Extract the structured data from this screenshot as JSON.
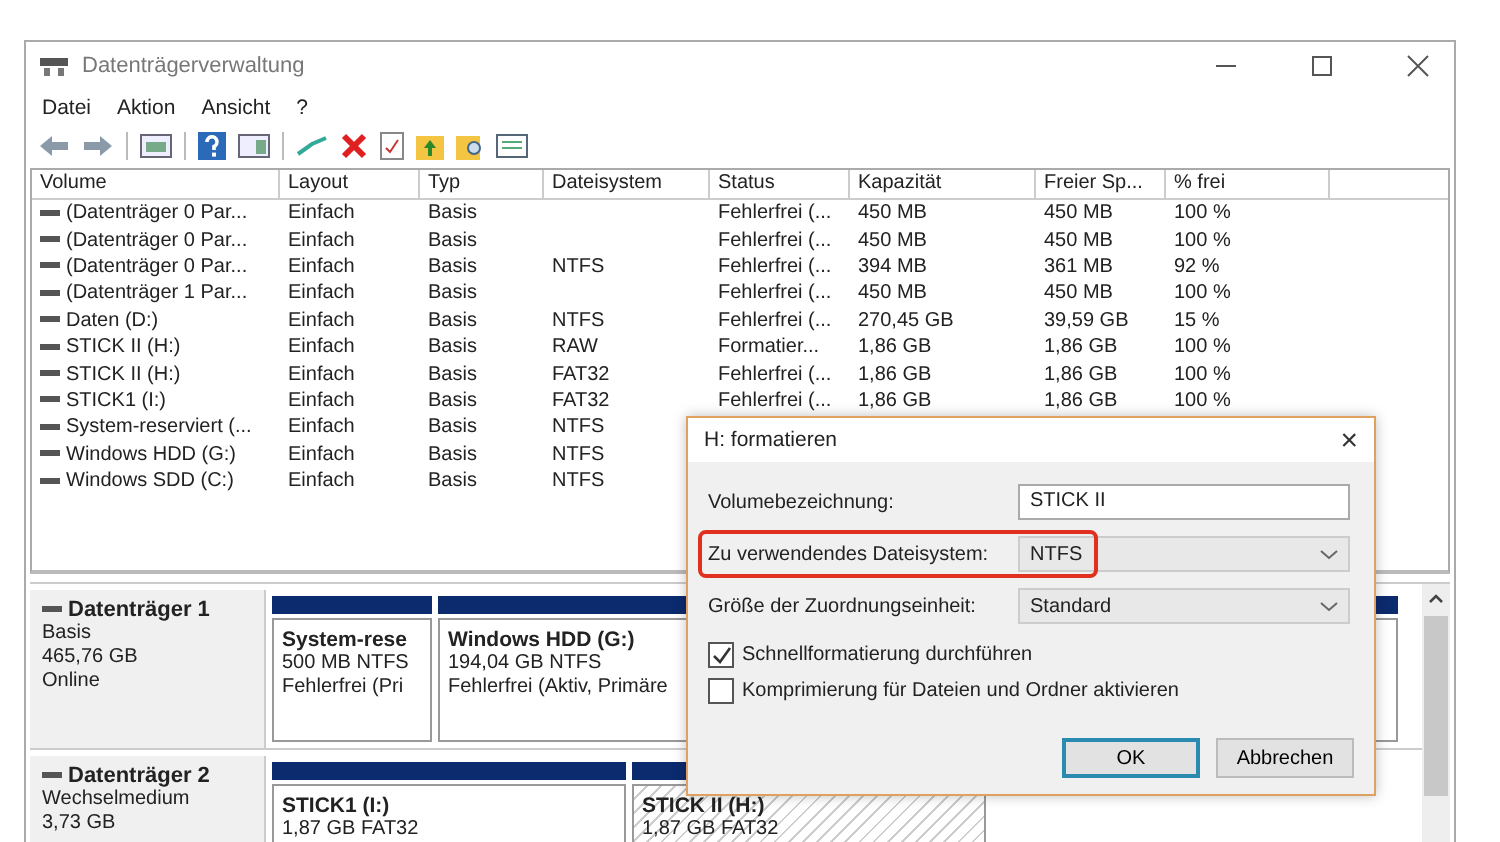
{
  "window": {
    "title": "Datenträgerverwaltung"
  },
  "menu": [
    "Datei",
    "Aktion",
    "Ansicht",
    "?"
  ],
  "table": {
    "columns": [
      "Volume",
      "Layout",
      "Typ",
      "Dateisystem",
      "Status",
      "Kapazität",
      "Freier Sp...",
      "% frei"
    ],
    "rows": [
      {
        "volume": "(Datenträger 0 Par...",
        "layout": "Einfach",
        "type": "Basis",
        "status": "Fehlerfrei (...",
        "capacity": "450 MB",
        "free": "450 MB",
        "percent_free": "100 %"
      },
      {
        "volume": "(Datenträger 0 Par...",
        "layout": "Einfach",
        "type": "Basis",
        "status": "Fehlerfrei (...",
        "capacity": "450 MB",
        "free": "450 MB",
        "percent_free": "100 %"
      },
      {
        "volume": "(Datenträger 0 Par...",
        "layout": "Einfach",
        "type": "Basis",
        "file_system": "NTFS",
        "status": "Fehlerfrei (...",
        "capacity": "394 MB",
        "free": "361 MB",
        "percent_free": "92 %"
      },
      {
        "volume": "(Datenträger 1 Par...",
        "layout": "Einfach",
        "type": "Basis",
        "status": "Fehlerfrei (...",
        "capacity": "450 MB",
        "free": "450 MB",
        "percent_free": "100 %"
      },
      {
        "volume": "Daten (D:)",
        "layout": "Einfach",
        "type": "Basis",
        "file_system": "NTFS",
        "status": "Fehlerfrei (...",
        "capacity": "270,45 GB",
        "free": "39,59 GB",
        "percent_free": "15 %"
      },
      {
        "volume": "STICK II (H:)",
        "layout": "Einfach",
        "type": "Basis",
        "file_system": "RAW",
        "status": "Formatier...",
        "capacity": "1,86 GB",
        "free": "1,86 GB",
        "percent_free": "100 %"
      },
      {
        "volume": "STICK II (H:)",
        "layout": "Einfach",
        "type": "Basis",
        "file_system": "FAT32",
        "status": "Fehlerfrei (...",
        "capacity": "1,86 GB",
        "free": "1,86 GB",
        "percent_free": "100 %"
      },
      {
        "volume": "STICK1 (I:)",
        "layout": "Einfach",
        "type": "Basis",
        "file_system": "FAT32",
        "status": "Fehlerfrei (...",
        "capacity": "1,86 GB",
        "free": "1,86 GB",
        "percent_free": "100 %"
      },
      {
        "volume": "System-reserviert (...",
        "layout": "Einfach",
        "type": "Basis",
        "file_system": "NTFS"
      },
      {
        "volume": "Windows HDD (G:)",
        "layout": "Einfach",
        "type": "Basis",
        "file_system": "NTFS"
      },
      {
        "volume": "Windows SDD (C:)",
        "layout": "Einfach",
        "type": "Basis",
        "file_system": "NTFS"
      }
    ]
  },
  "disks": [
    {
      "name": "Datenträger 1",
      "lines": [
        "Basis",
        "465,76 GB",
        "Online"
      ],
      "partitions": [
        {
          "name": "System-rese",
          "lines": [
            "500 MB NTFS",
            "Fehlerfrei (Pri"
          ],
          "hatched": false
        },
        {
          "name": "Windows HDD  (G:)",
          "lines": [
            "194,04 GB NTFS",
            "Fehlerfrei (Aktiv, Primäre"
          ],
          "hatched": false
        }
      ]
    },
    {
      "name": "Datenträger 2",
      "lines": [
        "Wechselmedium",
        "3,73 GB"
      ],
      "partitions": [
        {
          "name": "STICK1  (I:)",
          "lines": [
            "1,87 GB FAT32"
          ],
          "hatched": false
        },
        {
          "name": "STICK II  (H:)",
          "lines": [
            "1,87 GB FAT32"
          ],
          "hatched": true
        }
      ]
    }
  ],
  "dialog": {
    "title": "H: formatieren",
    "close": "×",
    "fields": [
      {
        "kind": "text",
        "label": "Volumebezeichnung:",
        "value": "STICK II",
        "highlighted": false
      },
      {
        "kind": "select",
        "label": "Zu verwendendes Dateisystem:",
        "value": "NTFS",
        "highlighted": true
      },
      {
        "kind": "select",
        "label": "Größe der Zuordnungseinheit:",
        "value": "Standard",
        "highlighted": false
      }
    ],
    "options": [
      {
        "label": "Schnellformatierung durchführen",
        "checked": true
      },
      {
        "label": "Komprimierung für Dateien und Ordner aktivieren",
        "checked": false
      }
    ],
    "buttons": [
      {
        "label": "OK",
        "default": true
      },
      {
        "label": "Abbrechen",
        "default": false
      }
    ]
  }
}
